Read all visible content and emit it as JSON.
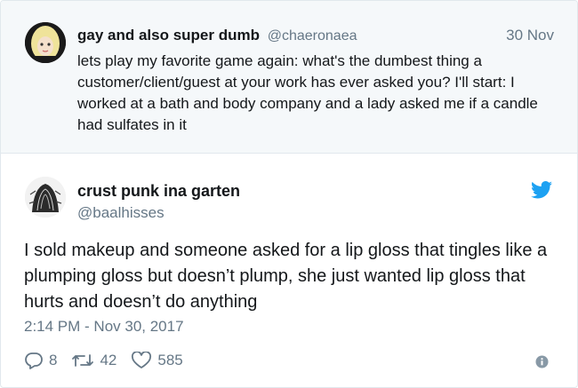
{
  "parent_tweet": {
    "display_name": "gay and also super dumb",
    "handle": "@chaeronaea",
    "date": "30 Nov",
    "text": "lets play my favorite game again: what's the dumbest thing a customer/client/guest at your work has ever asked you? I'll start: I worked at a bath and body company and a lady asked me if a candle had sulfates in it"
  },
  "tweet": {
    "display_name": "crust punk ina garten",
    "handle": "@baalhisses",
    "text": "I sold makeup and someone asked for a lip gloss that tingles like a plumping gloss but doesn’t plump, she just wanted lip gloss that hurts and doesn’t do anything",
    "timestamp": "2:14 PM - Nov 30, 2017",
    "reply_count": "8",
    "retweet_count": "42",
    "like_count": "585"
  },
  "icons": {
    "brand": "twitter-bird-icon",
    "reply": "reply-icon",
    "retweet": "retweet-icon",
    "like": "heart-icon",
    "info": "info-icon"
  },
  "colors": {
    "twitter_blue": "#1da1f2",
    "muted": "#657786",
    "text": "#14171a",
    "parent_bg": "#f5f8fa"
  }
}
